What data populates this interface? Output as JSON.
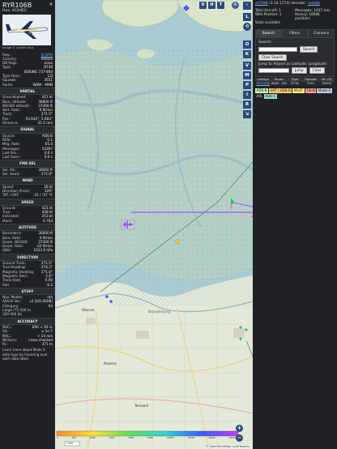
{
  "info": {
    "callsign": "RYR106B",
    "hex": "Hex: 4CA4EC",
    "photo_credit": "Image © Andrés Solá",
    "basic": [
      {
        "k": "Reg.:",
        "v": "EI-DPH",
        "link": true
      },
      {
        "k": "Country:",
        "v": "Ireland",
        "link": false
      },
      {
        "k": "DB flags:",
        "v": "none",
        "link": false
      },
      {
        "k": "Type:",
        "v": "B738",
        "link": false
      },
      {
        "k": "",
        "v": "BOEING 737-800",
        "link": false
      },
      {
        "k": "Type Desc.:",
        "v": "L2J",
        "link": false
      },
      {
        "k": "Squawk:",
        "v": "3551",
        "link": false
      },
      {
        "k": "Route:",
        "v": "WAW - MAN",
        "link": false
      }
    ],
    "sections": [
      {
        "title": "SPATIAL",
        "rows": [
          {
            "k": "Groundspeed:",
            "v": "421 kt"
          },
          {
            "k": "Baro. altitude:",
            "v": "36000 ft"
          },
          {
            "k": "WGS84 altitude:",
            "v": "37300 ft"
          },
          {
            "k": "Vert. Rate:",
            "v": "0 ft/min"
          },
          {
            "k": "Track:",
            "v": "271.5°"
          },
          {
            "k": "Pos.:",
            "v": "53.644°, 5.083°"
          },
          {
            "k": "Distance:",
            "v": "31.5 nmi"
          }
        ]
      },
      {
        "title": "SIGNAL",
        "rows": [
          {
            "k": "Source:",
            "v": "ADS-B"
          },
          {
            "k": "RSSI:",
            "v": "-5.1"
          },
          {
            "k": "Msg. Rate:",
            "v": "65.4"
          },
          {
            "k": "Messages:",
            "v": "54397"
          },
          {
            "k": "Last Pos.:",
            "v": "0.0 s"
          },
          {
            "k": "Last Seen:",
            "v": "0.0 s"
          }
        ]
      },
      {
        "title": "FMS SEL",
        "rows": [
          {
            "k": "Sel. Alt.:",
            "v": "36000 ft"
          },
          {
            "k": "Sel. Head.:",
            "v": "272.8°"
          }
        ]
      },
      {
        "title": "WIND",
        "rows": [
          {
            "k": "Speed:",
            "v": "26 kt"
          },
          {
            "k": "Direction (from):",
            "v": "329°"
          },
          {
            "k": "TAT / OAT:",
            "v": "-31 / -57 °C"
          }
        ]
      },
      {
        "title": "SPEED",
        "rows": [
          {
            "k": "Ground:",
            "v": "421 kt"
          },
          {
            "k": "True:",
            "v": "438 kt"
          },
          {
            "k": "Indicated:",
            "v": "253 kt"
          },
          {
            "k": "Mach:",
            "v": "0.764"
          }
        ]
      },
      {
        "title": "ALTITUDE",
        "rows": [
          {
            "k": "Barometric:",
            "v": "36000 ft"
          },
          {
            "k": "Baro. Rate:",
            "v": "0 ft/min"
          },
          {
            "k": "Geom. WGS84:",
            "v": "37300 ft"
          },
          {
            "k": "Geom. Rate:",
            "v": "-32 ft/min"
          },
          {
            "k": "QNH:",
            "v": "1013.6 hPa"
          }
        ]
      },
      {
        "title": "DIRECTION",
        "rows": [
          {
            "k": "Ground Track:",
            "v": "271.5°"
          },
          {
            "k": "True Heading:",
            "v": "274.2°"
          },
          {
            "k": "Magnetic Heading:",
            "v": "271.6°"
          },
          {
            "k": "Magnetic Decl.:",
            "v": "2.6°"
          },
          {
            "k": "Track Rate:",
            "v": "0.00"
          },
          {
            "k": "Roll:",
            "v": "-0.2"
          }
        ]
      },
      {
        "title": "STUFF",
        "rows": [
          {
            "k": "Nav. Modes:",
            "v": "n/a"
          },
          {
            "k": "ADS-B Ver.:",
            "v": "v2 (DO-260B)"
          },
          {
            "k": "Category:",
            "v": "A3"
          },
          {
            "k": "Large (75 000 to",
            "v": ""
          },
          {
            "k": "300 000 lb)",
            "v": ""
          }
        ]
      },
      {
        "title": "ACCURACY",
        "rows": [
          {
            "k": "NACₚ:",
            "v": "EPU < 92 m"
          },
          {
            "k": "SIL:",
            "v": "≤ 1e-7"
          },
          {
            "k": "NACᵥ:",
            "v": "< 10 m/s"
          },
          {
            "k": "NICbaro:",
            "v": "cross-checked"
          },
          {
            "k": "Rc:",
            "v": "371 m"
          }
        ]
      }
    ],
    "footer": "Learn more about Mode S data type by hovering over each data label."
  },
  "sidebar": {
    "version_prefix": "",
    "version_link": "ar1098",
    "version_rest": " (3.14.1774) decoder: ",
    "readsb": "readsb",
    "stats": [
      {
        "l": "Total Aircraft: 1",
        "r": "Messages: 1437 /sec"
      },
      {
        "l": "With Position: 1",
        "r": "History: 18566 positions"
      },
      {
        "l": "Stats available",
        "r": ""
      }
    ],
    "tabs": [
      "Search",
      "Filters",
      "Columns"
    ],
    "search_label": "Search:",
    "search_btn": "Search",
    "clear_btn": "Clear Search",
    "jump_label": "Jump to Airport or Latitude, Longitude:",
    "jump_btn": "Jump",
    "jump_clear": "Clear",
    "table_headers": [
      "Callsign",
      "Route",
      "Type",
      "Squawk",
      "Alt. (ft)"
    ],
    "table_row": [
      "RYR106B",
      "WAW - MAN",
      "B738",
      "3551",
      "36000"
    ],
    "legend": [
      {
        "t": "ADS-B",
        "c": "#c5f0c0"
      },
      {
        "t": "UAT / ADS-R",
        "c": "#f7c66e"
      },
      {
        "t": "MLAT",
        "c": "#f7ec79"
      },
      {
        "t": "TIS-B",
        "c": "#f79a8c"
      },
      {
        "t": "Mode-S",
        "c": "#bcc8e6"
      },
      {
        "t": "AIS",
        "c": "#1f2124",
        "fg": "#ddd"
      },
      {
        "t": "ADS-C",
        "c": "#9ddcc0"
      }
    ]
  },
  "map": {
    "top_buttons": [
      "U",
      "H",
      "T"
    ],
    "vert_buttons": [
      "L",
      "O",
      "K",
      "V",
      "M",
      "P",
      "I",
      "R"
    ],
    "scale_label": "1 km",
    "attribution": "© OpenStreetMap contributors.",
    "place_labels": [
      "Wierum",
      "Peasens",
      "Ternaard",
      "Brandenburg"
    ],
    "alt_scale": [
      "0",
      "500",
      "1000",
      "2000",
      "4000",
      "6000",
      "10000",
      "20000",
      "30000",
      "40000+"
    ]
  }
}
